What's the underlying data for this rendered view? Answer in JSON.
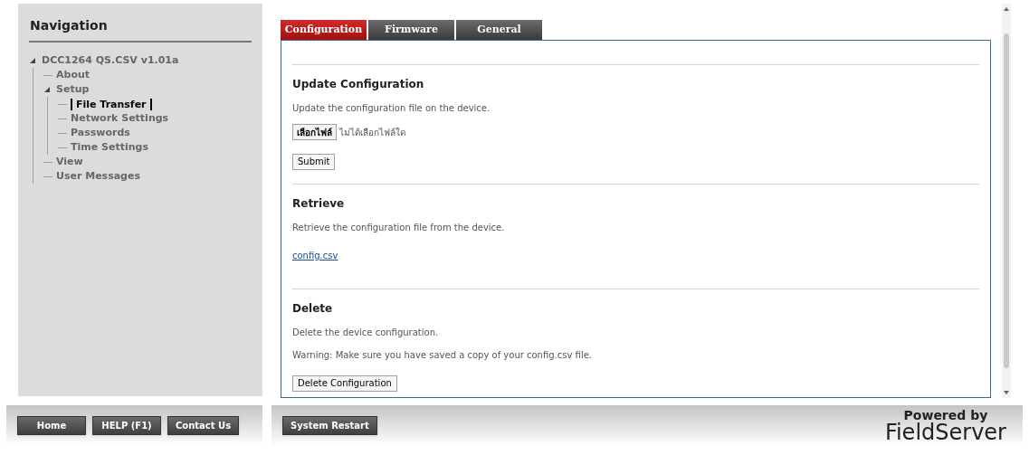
{
  "navigation": {
    "title": "Navigation",
    "tree": [
      {
        "label": "DCC1264 QS.CSV v1.01a",
        "expanded": true,
        "selected": false,
        "children": [
          {
            "label": "About",
            "selected": false
          },
          {
            "label": "Setup",
            "expanded": true,
            "selected": false,
            "children": [
              {
                "label": "File Transfer",
                "selected": true
              },
              {
                "label": "Network Settings",
                "selected": false
              },
              {
                "label": "Passwords",
                "selected": false
              },
              {
                "label": "Time Settings",
                "selected": false
              }
            ]
          },
          {
            "label": "View",
            "selected": false
          },
          {
            "label": "User Messages",
            "selected": false
          }
        ]
      }
    ]
  },
  "tabs": [
    {
      "label": "Configuration",
      "selected": true
    },
    {
      "label": "Firmware",
      "selected": false
    },
    {
      "label": "General",
      "selected": false
    }
  ],
  "sections": [
    {
      "title": "Update Configuration",
      "texts": [
        "Update the configuration file on the device."
      ],
      "file_input": {
        "button": "เลือกไฟล์",
        "status": "ไม่ได้เลือกไฟล์ใด"
      },
      "button": "Submit"
    },
    {
      "title": "Retrieve",
      "texts": [
        "Retrieve the configuration file from the device."
      ],
      "link": "config.csv"
    },
    {
      "title": "Delete",
      "texts": [
        "Delete the device configuration.",
        "Warning: Make sure you have saved a copy of your config.csv file."
      ],
      "button": "Delete Configuration"
    }
  ],
  "footer_left_buttons": [
    "Home",
    "HELP (F1)",
    "Contact Us"
  ],
  "footer_main_buttons": [
    "System Restart"
  ],
  "branding": {
    "line_1": "Powered by",
    "line_2": "FieldServer"
  }
}
